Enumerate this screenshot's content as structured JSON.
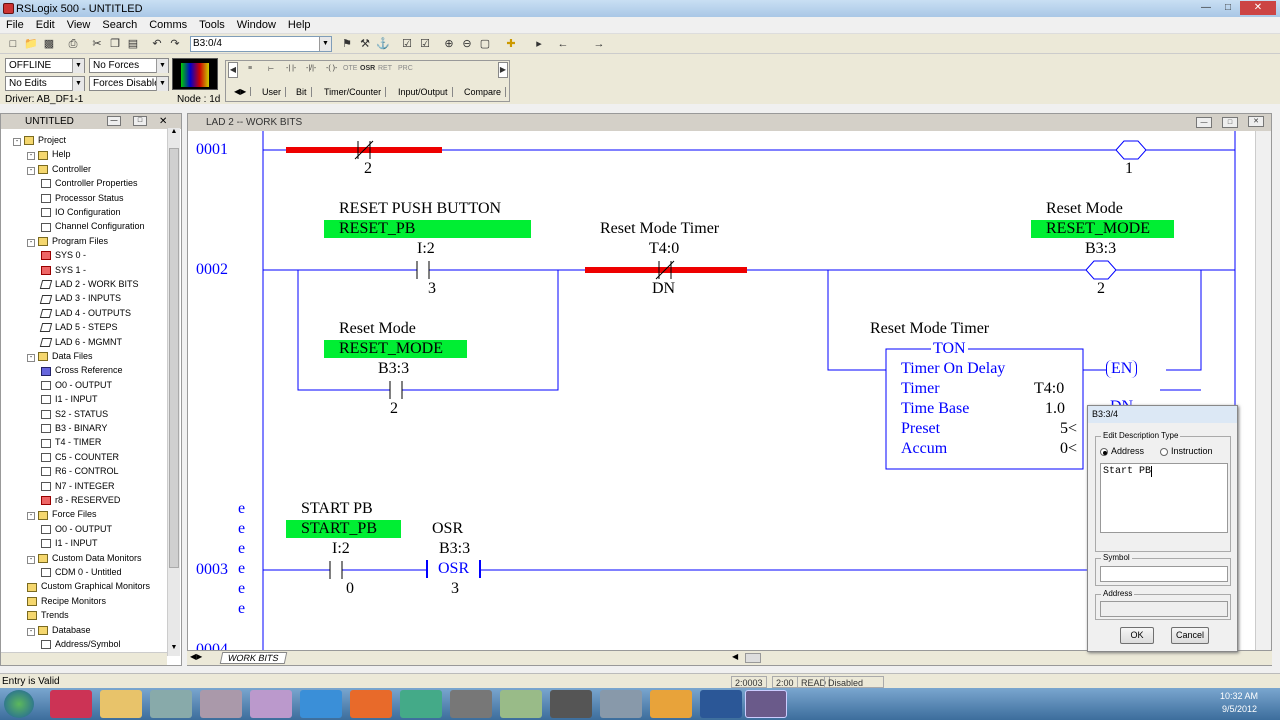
{
  "window": {
    "title": "RSLogix 500 - UNTITLED"
  },
  "menu": [
    "File",
    "Edit",
    "View",
    "Search",
    "Comms",
    "Tools",
    "Window",
    "Help"
  ],
  "toolbar": {
    "address_combo": "B3:0/4"
  },
  "status": {
    "mode": "OFFLINE",
    "forces": "No Forces",
    "edits": "No Edits",
    "forces_enabled": "Forces Disabled",
    "driver": "Driver: AB_DF1-1",
    "node": "Node : 1d"
  },
  "instruction_bar": {
    "tabs": [
      "User",
      "Bit",
      "Timer/Counter",
      "Input/Output",
      "Compare"
    ],
    "small": [
      "OSR",
      "OTE",
      "RET",
      "PRC"
    ]
  },
  "project_panel": {
    "title": "UNTITLED",
    "items": [
      {
        "label": "Project"
      },
      {
        "label": "Help"
      },
      {
        "label": "Controller"
      },
      {
        "label": "Controller Properties"
      },
      {
        "label": "Processor Status"
      },
      {
        "label": "IO Configuration"
      },
      {
        "label": "Channel Configuration"
      },
      {
        "label": "Program Files"
      },
      {
        "label": "SYS 0 -"
      },
      {
        "label": "SYS 1 -"
      },
      {
        "label": "LAD 2 - WORK BITS"
      },
      {
        "label": "LAD 3 - INPUTS"
      },
      {
        "label": "LAD 4 - OUTPUTS"
      },
      {
        "label": "LAD 5 - STEPS"
      },
      {
        "label": "LAD 6 - MGMNT"
      },
      {
        "label": "Data Files"
      },
      {
        "label": "Cross Reference"
      },
      {
        "label": "O0 - OUTPUT"
      },
      {
        "label": "I1 - INPUT"
      },
      {
        "label": "S2 - STATUS"
      },
      {
        "label": "B3 - BINARY"
      },
      {
        "label": "T4 - TIMER"
      },
      {
        "label": "C5 - COUNTER"
      },
      {
        "label": "R6 - CONTROL"
      },
      {
        "label": "N7 - INTEGER"
      },
      {
        "label": "r8 - RESERVED"
      },
      {
        "label": "Force Files"
      },
      {
        "label": "O0 - OUTPUT"
      },
      {
        "label": "I1 - INPUT"
      },
      {
        "label": "Custom Data Monitors"
      },
      {
        "label": "CDM 0 - Untitled"
      },
      {
        "label": "Custom Graphical Monitors"
      },
      {
        "label": "Recipe Monitors"
      },
      {
        "label": "Trends"
      },
      {
        "label": "Database"
      },
      {
        "label": "Address/Symbol"
      }
    ]
  },
  "ladder": {
    "title": "LAD 2 -- WORK BITS",
    "rungs": {
      "r1": "0001",
      "r2": "0002",
      "r3": "0003",
      "r4": "0004"
    },
    "r1": {
      "contact_bit": "2",
      "coil_bit": "1"
    },
    "r2": {
      "pb_desc": "RESET PUSH BUTTON",
      "pb_sym": "RESET_PB",
      "pb_addr": "I:2",
      "pb_bit": "3",
      "tmr_desc": "Reset Mode Timer",
      "tmr_addr": "T4:0",
      "tmr_bit": "DN",
      "coil_desc": "Reset Mode",
      "coil_sym": "RESET_MODE",
      "coil_addr": "B3:3",
      "coil_bit": "2",
      "br_desc": "Reset Mode",
      "br_sym": "RESET_MODE",
      "br_addr": "B3:3",
      "br_bit": "2",
      "ton_desc": "Reset Mode Timer",
      "ton_title": "TON",
      "ton_name": "Timer On Delay",
      "ton_timer_l": "Timer",
      "ton_timer_v": "T4:0",
      "ton_base_l": "Time Base",
      "ton_base_v": "1.0",
      "ton_preset_l": "Preset",
      "ton_preset_v": "5<",
      "ton_accum_l": "Accum",
      "ton_accum_v": "0<",
      "en": "EN",
      "dn": "DN"
    },
    "r3": {
      "pb_desc": "START PB",
      "pb_sym": "START_PB",
      "pb_addr": "I:2",
      "pb_bit": "0",
      "osr_desc": "OSR",
      "osr_addr": "B3:3",
      "osr_label": "OSR",
      "osr_bit": "3",
      "e": "e"
    },
    "tab": "WORK BITS"
  },
  "dialog": {
    "title": "B3:3/4",
    "group": "Edit Description Type",
    "opt_address": "Address",
    "opt_instruction": "Instruction",
    "text": "Start PB",
    "symbol_label": "Symbol",
    "address_label": "Address",
    "ok": "OK",
    "cancel": "Cancel"
  },
  "statusbar": {
    "msg": "Entry is Valid",
    "c1": "2:0003",
    "c2": "2:00",
    "c3": "READ",
    "c4": "Disabled"
  },
  "clock": {
    "time": "10:32 AM",
    "date": "9/5/2012"
  }
}
